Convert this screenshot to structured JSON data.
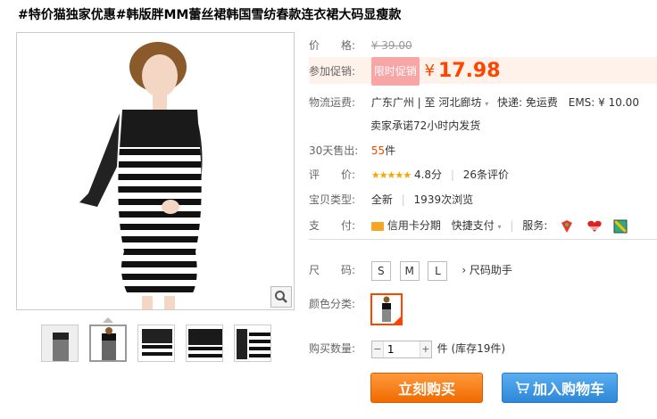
{
  "product": {
    "title": "#特价猫独家优惠#韩版胖MM蕾丝裙韩国雪纺春款连衣裙大码显瘦款"
  },
  "price": {
    "label": "价　　格:",
    "original": "¥ 39.00",
    "promo_label": "参加促销:",
    "promo_badge": "限时促销",
    "yen": "¥",
    "current": "17.98"
  },
  "shipping": {
    "label": "物流运费:",
    "from": "广东广州",
    "to_sep": "| 至",
    "to": "河北廊坊",
    "express": "快递: 免运费",
    "ems": "EMS: ¥ 10.00",
    "promise": "卖家承诺72小时内发货"
  },
  "sales": {
    "label": "30天售出:",
    "count": "55",
    "unit": "件"
  },
  "rating": {
    "label": "评　　价:",
    "stars": "★★★★★",
    "score": "4.8分",
    "reviews": "26条评价"
  },
  "type": {
    "label": "宝贝类型:",
    "condition": "全新",
    "views": "1939次浏览"
  },
  "payment": {
    "label": "支　　付:",
    "credit": "信用卡分期",
    "quick": "快捷支付",
    "service_label": "服务:"
  },
  "size": {
    "label": "尺　　码:",
    "options": [
      "S",
      "M",
      "L"
    ],
    "helper": "› 尺码助手"
  },
  "color": {
    "label": "颜色分类:"
  },
  "quantity": {
    "label": "购买数量:",
    "value": "1",
    "unit_stock": "件 (库存19件)"
  },
  "actions": {
    "buy": "立刻购买",
    "cart": "加入购物车"
  },
  "theme": {
    "accent": "#ff4400",
    "buy_button": "#f06a00",
    "cart_button": "#2e88d8"
  }
}
